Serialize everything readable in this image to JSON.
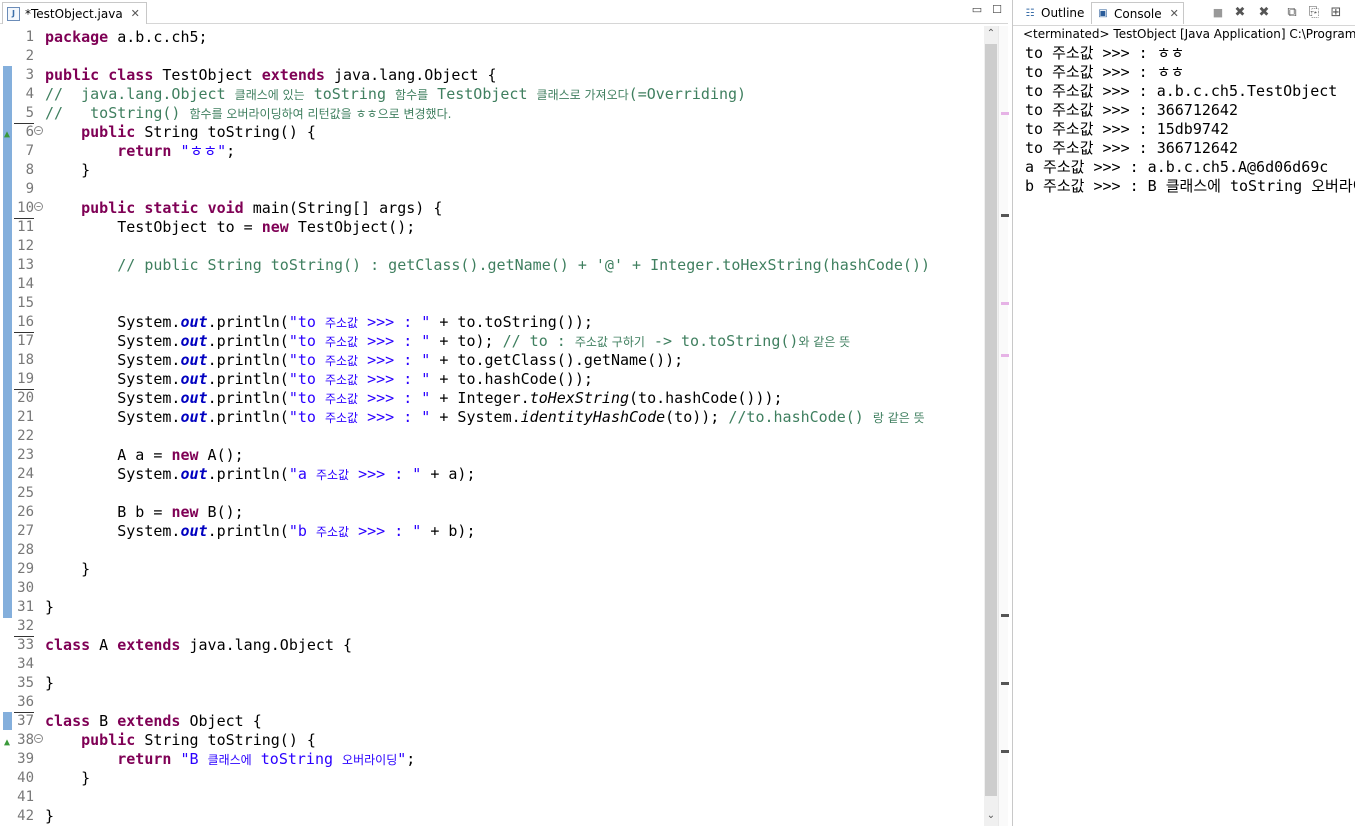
{
  "editor": {
    "tab_label": "*TestObject.java",
    "lines": [
      {
        "n": "1",
        "html": "<span class='kw'>package</span> a.b.c.ch5;"
      },
      {
        "n": "2",
        "html": ""
      },
      {
        "n": "3",
        "html": "<span class='kw'>public</span> <span class='kw'>class</span> TestObject <span class='kw'>extends</span> java.lang.Object {"
      },
      {
        "n": "4",
        "html": "<span class='cm'>//  java.lang.Object <span class='kr'>클래스에 있는</span> toString <span class='kr'>함수를</span> TestObject <span class='kr'>클래스로 가져오다</span>(=Overriding)</span>"
      },
      {
        "n": "5",
        "html": "<span class='cm'>//   toString() <span class='kr'>함수를 오버라이딩하여 리턴값을 ㅎㅎ으로 변경했다.</span></span>"
      },
      {
        "n": "6",
        "html": "    <span class='kw'>public</span> String toString() {"
      },
      {
        "n": "7",
        "html": "        <span class='kw'>return</span> <span class='str'>\"ㅎㅎ\"</span>;"
      },
      {
        "n": "8",
        "html": "    }"
      },
      {
        "n": "9",
        "html": ""
      },
      {
        "n": "10",
        "html": "    <span class='kw'>public</span> <span class='kw'>static</span> <span class='kw'>void</span> main(String[] args) {"
      },
      {
        "n": "11",
        "html": "        TestObject to = <span class='kw'>new</span> TestObject();"
      },
      {
        "n": "12",
        "html": ""
      },
      {
        "n": "13",
        "html": "        <span class='cm'>// public String toString() : getClass().getName() + '@' + Integer.toHexString(hashCode())</span>"
      },
      {
        "n": "14",
        "html": ""
      },
      {
        "n": "15",
        "html": ""
      },
      {
        "n": "16",
        "html": "        System.<span class='fld'>out</span>.println(<span class='str'>\"to <span class='kr'>주소값</span> &gt;&gt;&gt; : \"</span> + to.toString());"
      },
      {
        "n": "17",
        "html": "        System.<span class='fld'>out</span>.println(<span class='str'>\"to <span class='kr'>주소값</span> &gt;&gt;&gt; : \"</span> + to); <span class='cm'>// to : <span class='kr'>주소값 구하기</span> -&gt; to.toString()<span class='kr'>와 같은 뜻</span></span>"
      },
      {
        "n": "18",
        "html": "        System.<span class='fld'>out</span>.println(<span class='str'>\"to <span class='kr'>주소값</span> &gt;&gt;&gt; : \"</span> + to.getClass().getName());"
      },
      {
        "n": "19",
        "html": "        System.<span class='fld'>out</span>.println(<span class='str'>\"to <span class='kr'>주소값</span> &gt;&gt;&gt; : \"</span> + to.hashCode());"
      },
      {
        "n": "20",
        "html": "        System.<span class='fld'>out</span>.println(<span class='str'>\"to <span class='kr'>주소값</span> &gt;&gt;&gt; : \"</span> + Integer.<span class='it'>toHexString</span>(to.hashCode()));"
      },
      {
        "n": "21",
        "html": "        System.<span class='fld'>out</span>.println(<span class='str'>\"to <span class='kr'>주소값</span> &gt;&gt;&gt; : \"</span> + System.<span class='it'>identityHashCode</span>(to)); <span class='cm'>//to.hashCode() <span class='kr'>랑 같은 뜻</span></span>"
      },
      {
        "n": "22",
        "html": ""
      },
      {
        "n": "23",
        "html": "        A a = <span class='kw'>new</span> A();"
      },
      {
        "n": "24",
        "html": "        System.<span class='fld'>out</span>.println(<span class='str'>\"a <span class='kr'>주소값</span> &gt;&gt;&gt; : \"</span> + a);"
      },
      {
        "n": "25",
        "html": ""
      },
      {
        "n": "26",
        "html": "        B b = <span class='kw'>new</span> B();"
      },
      {
        "n": "27",
        "html": "        System.<span class='fld'>out</span>.println(<span class='str'>\"b <span class='kr'>주소값</span> &gt;&gt;&gt; : \"</span> + b);"
      },
      {
        "n": "28",
        "html": ""
      },
      {
        "n": "29",
        "html": "    }"
      },
      {
        "n": "30",
        "html": ""
      },
      {
        "n": "31",
        "html": "}"
      },
      {
        "n": "32",
        "html": ""
      },
      {
        "n": "33",
        "html": "<span class='kw'>class</span> A <span class='kw'>extends</span> java.lang.Object {"
      },
      {
        "n": "34",
        "html": ""
      },
      {
        "n": "35",
        "html": "}"
      },
      {
        "n": "36",
        "html": ""
      },
      {
        "n": "37",
        "html": "<span class='kw'>class</span> B <span class='kw'>extends</span> Object {"
      },
      {
        "n": "38",
        "html": "    <span class='kw'>public</span> String toString() {"
      },
      {
        "n": "39",
        "html": "        <span class='kw'>return</span> <span class='str'>\"B <span class='kr'>클래스에</span> toString <span class='kr'>오버라이딩</span>\"</span>;"
      },
      {
        "n": "40",
        "html": "    }"
      },
      {
        "n": "41",
        "html": ""
      },
      {
        "n": "42",
        "html": "}"
      }
    ]
  },
  "right_panel": {
    "outline_tab": "Outline",
    "console_tab": "Console",
    "status": "<terminated> TestObject [Java Application] C:\\Program Files\\",
    "output": [
      "to 주소값 >>> : ㅎㅎ",
      "to 주소값 >>> : ㅎㅎ",
      "to 주소값 >>> : a.b.c.ch5.TestObject",
      "to 주소값 >>> : 366712642",
      "to 주소값 >>> : 15db9742",
      "to 주소값 >>> : 366712642",
      "a 주소값 >>> : a.b.c.ch5.A@6d06d69c",
      "b 주소값 >>> : B 클래스에 toString 오버라이딩"
    ]
  },
  "colors": {
    "keyword": "#7f0055",
    "string": "#2a00ff",
    "comment": "#3f7f5f",
    "field": "#0000c0",
    "change_bar": "#6ea1d6"
  },
  "icons": {
    "java_file": "java-file-icon",
    "outline": "outline-icon",
    "console": "console-icon",
    "terminate": "terminate-icon",
    "remove_launch": "remove-launch-icon",
    "remove_all": "remove-all-icon",
    "scroll_lock": "scroll-lock-icon",
    "word_wrap": "word-wrap-icon",
    "pin": "pin-icon",
    "minimize": "minimize-icon",
    "maximize": "maximize-icon"
  }
}
